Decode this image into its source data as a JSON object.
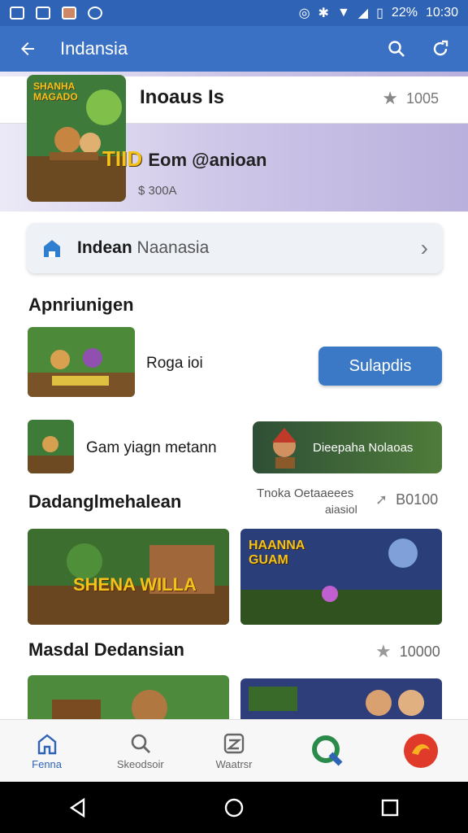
{
  "status": {
    "battery": "22%",
    "time": "10:30"
  },
  "appbar": {
    "title": "Indansia"
  },
  "banner": {
    "app_title": "Inoaus Is",
    "rating": "1005",
    "headline_yellow": "TIID",
    "headline_dark": "Eom @anioan",
    "sub": "$ 300A",
    "thumb_text": "SHANHA MAGADO"
  },
  "search_card": {
    "bold": "Indean",
    "rest": "Naanasia"
  },
  "section1": {
    "title": "Apnriunigen"
  },
  "row1": {
    "label": "Roga ioi",
    "button": "Sulapdis"
  },
  "row2": {
    "label": "Gam yiagn metann",
    "card": "Dieepaha Nolaoas"
  },
  "section2": {
    "title": "Dadanglmehalean",
    "meta_line1": "Tnoka Oetaaeees",
    "meta_line2": "aiasiol",
    "rating": "B0100",
    "left_banner": "SHENA WILLA",
    "right_banner": "HAANNA GUAM"
  },
  "section3": {
    "title": "Masdal Dedansian",
    "rating": "10000"
  },
  "bottom_nav": [
    "Fenna",
    "Skeodsoir",
    "Waatrsr",
    "",
    ""
  ],
  "colors": {
    "primary": "#3a71c4",
    "status": "#2f63b5"
  }
}
